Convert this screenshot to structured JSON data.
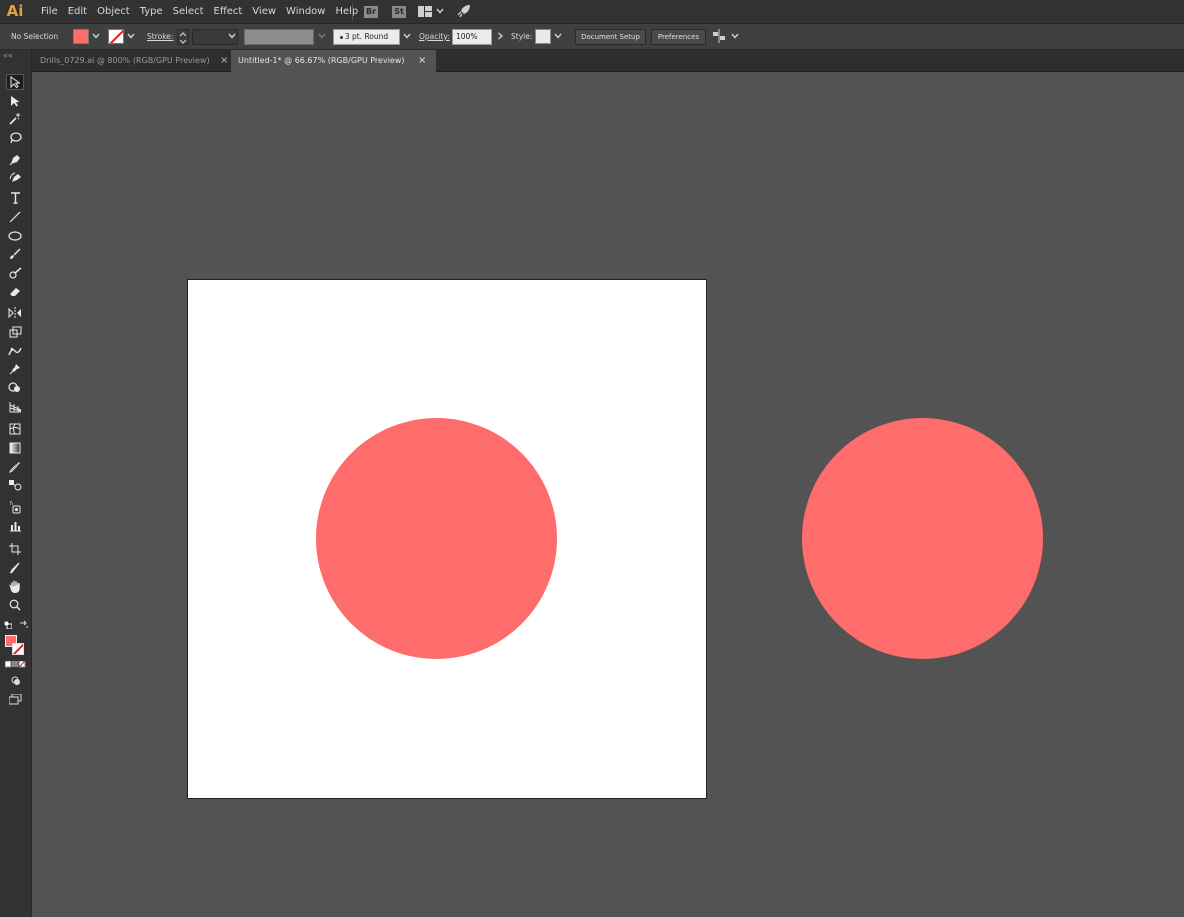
{
  "app": {
    "logo": "Ai"
  },
  "menu": {
    "items": [
      "File",
      "Edit",
      "Object",
      "Type",
      "Select",
      "Effect",
      "View",
      "Window",
      "Help"
    ],
    "bridge": "Br",
    "stock": "St"
  },
  "controlbar": {
    "selection_label": "No Selection",
    "fill_color": "#ff6c6c",
    "stroke_label": "Stroke:",
    "brush_label": "3 pt. Round",
    "opacity_label": "Opacity:",
    "opacity_value": "100%",
    "style_label": "Style:",
    "document_setup": "Document Setup",
    "preferences": "Preferences"
  },
  "tabs": [
    {
      "label": "Drills_0729.ai @ 800% (RGB/GPU Preview)",
      "active": false
    },
    {
      "label": "Untitled-1* @ 66.67% (RGB/GPU Preview)",
      "active": true
    }
  ],
  "tab_close": "×",
  "toolbar": {
    "tools": [
      "selection-tool",
      "direct-selection-tool",
      "magic-wand-tool",
      "lasso-tool",
      "pen-tool",
      "curvature-tool",
      "type-tool",
      "line-segment-tool",
      "ellipse-tool",
      "paintbrush-tool",
      "shaper-tool",
      "eraser-tool",
      "reflect-tool",
      "scale-tool",
      "puppet-warp-tool",
      "pin-tool",
      "shape-builder-tool",
      "perspective-grid-tool",
      "mesh-tool",
      "gradient-tool",
      "eyedropper-tool",
      "blend-tool",
      "symbol-sprayer-tool",
      "column-graph-tool",
      "artboard-tool",
      "slice-tool",
      "hand-tool",
      "zoom-tool"
    ],
    "fill_color": "#ff6c6c",
    "stroke": "none"
  },
  "canvas": {
    "background": "#535353",
    "artboard_color": "#ffffff",
    "shapes": [
      {
        "type": "ellipse",
        "fill": "#ff6c6c",
        "on_artboard": true
      },
      {
        "type": "ellipse",
        "fill": "#ff6c6c",
        "on_artboard": false
      }
    ]
  }
}
